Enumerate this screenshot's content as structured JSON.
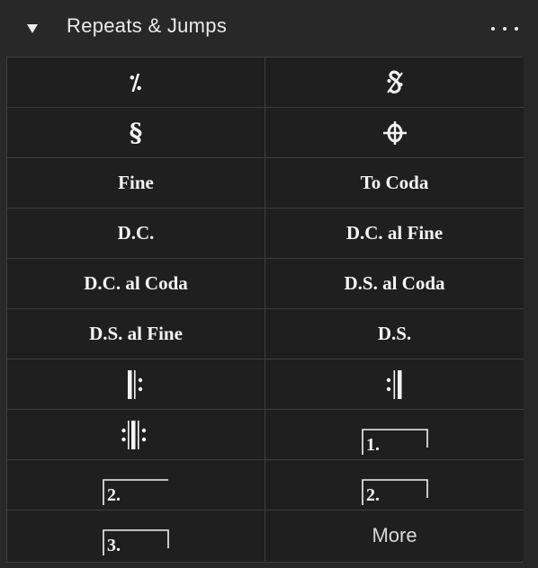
{
  "panel": {
    "title": "Repeats & Jumps",
    "collapse_icon": "triangle-down-icon",
    "menu_icon": "more-dots-icon"
  },
  "items": [
    {
      "name": "repeat-bar-cell",
      "icon": "repeat-bar-icon",
      "glyph": "𝄎"
    },
    {
      "name": "segno-cell",
      "icon": "segno-icon",
      "glyph": "𝄋"
    },
    {
      "name": "segno-alt-cell",
      "icon": "segno-serpent-icon",
      "glyph": "§"
    },
    {
      "name": "coda-cell",
      "icon": "coda-icon",
      "glyph": "𝄌"
    },
    {
      "name": "fine-cell",
      "label": "Fine"
    },
    {
      "name": "to-coda-cell",
      "label": "To Coda"
    },
    {
      "name": "dc-cell",
      "label": "D.C."
    },
    {
      "name": "dc-al-fine-cell",
      "label": "D.C. al Fine"
    },
    {
      "name": "dc-al-coda-cell",
      "label": "D.C. al Coda"
    },
    {
      "name": "ds-al-coda-cell",
      "label": "D.S. al Coda"
    },
    {
      "name": "ds-al-fine-cell",
      "label": "D.S. al Fine"
    },
    {
      "name": "ds-cell",
      "label": "D.S."
    },
    {
      "name": "start-repeat-cell",
      "icon": "start-repeat-barline-icon"
    },
    {
      "name": "end-repeat-cell",
      "icon": "end-repeat-barline-icon"
    },
    {
      "name": "end-start-repeat-cell",
      "icon": "end-start-repeat-barline-icon"
    },
    {
      "name": "volta-1-cell",
      "icon": "volta-bracket-icon",
      "volta": "1."
    },
    {
      "name": "volta-2-open-cell",
      "icon": "volta-bracket-open-icon",
      "volta": "2."
    },
    {
      "name": "volta-2-closed-cell",
      "icon": "volta-bracket-icon",
      "volta": "2."
    },
    {
      "name": "volta-3-cell",
      "icon": "volta-bracket-icon",
      "volta": "3."
    },
    {
      "name": "more-cell",
      "label": "More"
    }
  ],
  "colors": {
    "background": "#282829",
    "cell": "#1f1f20",
    "border": "#3e3e40",
    "text": "#f4f4f4"
  }
}
